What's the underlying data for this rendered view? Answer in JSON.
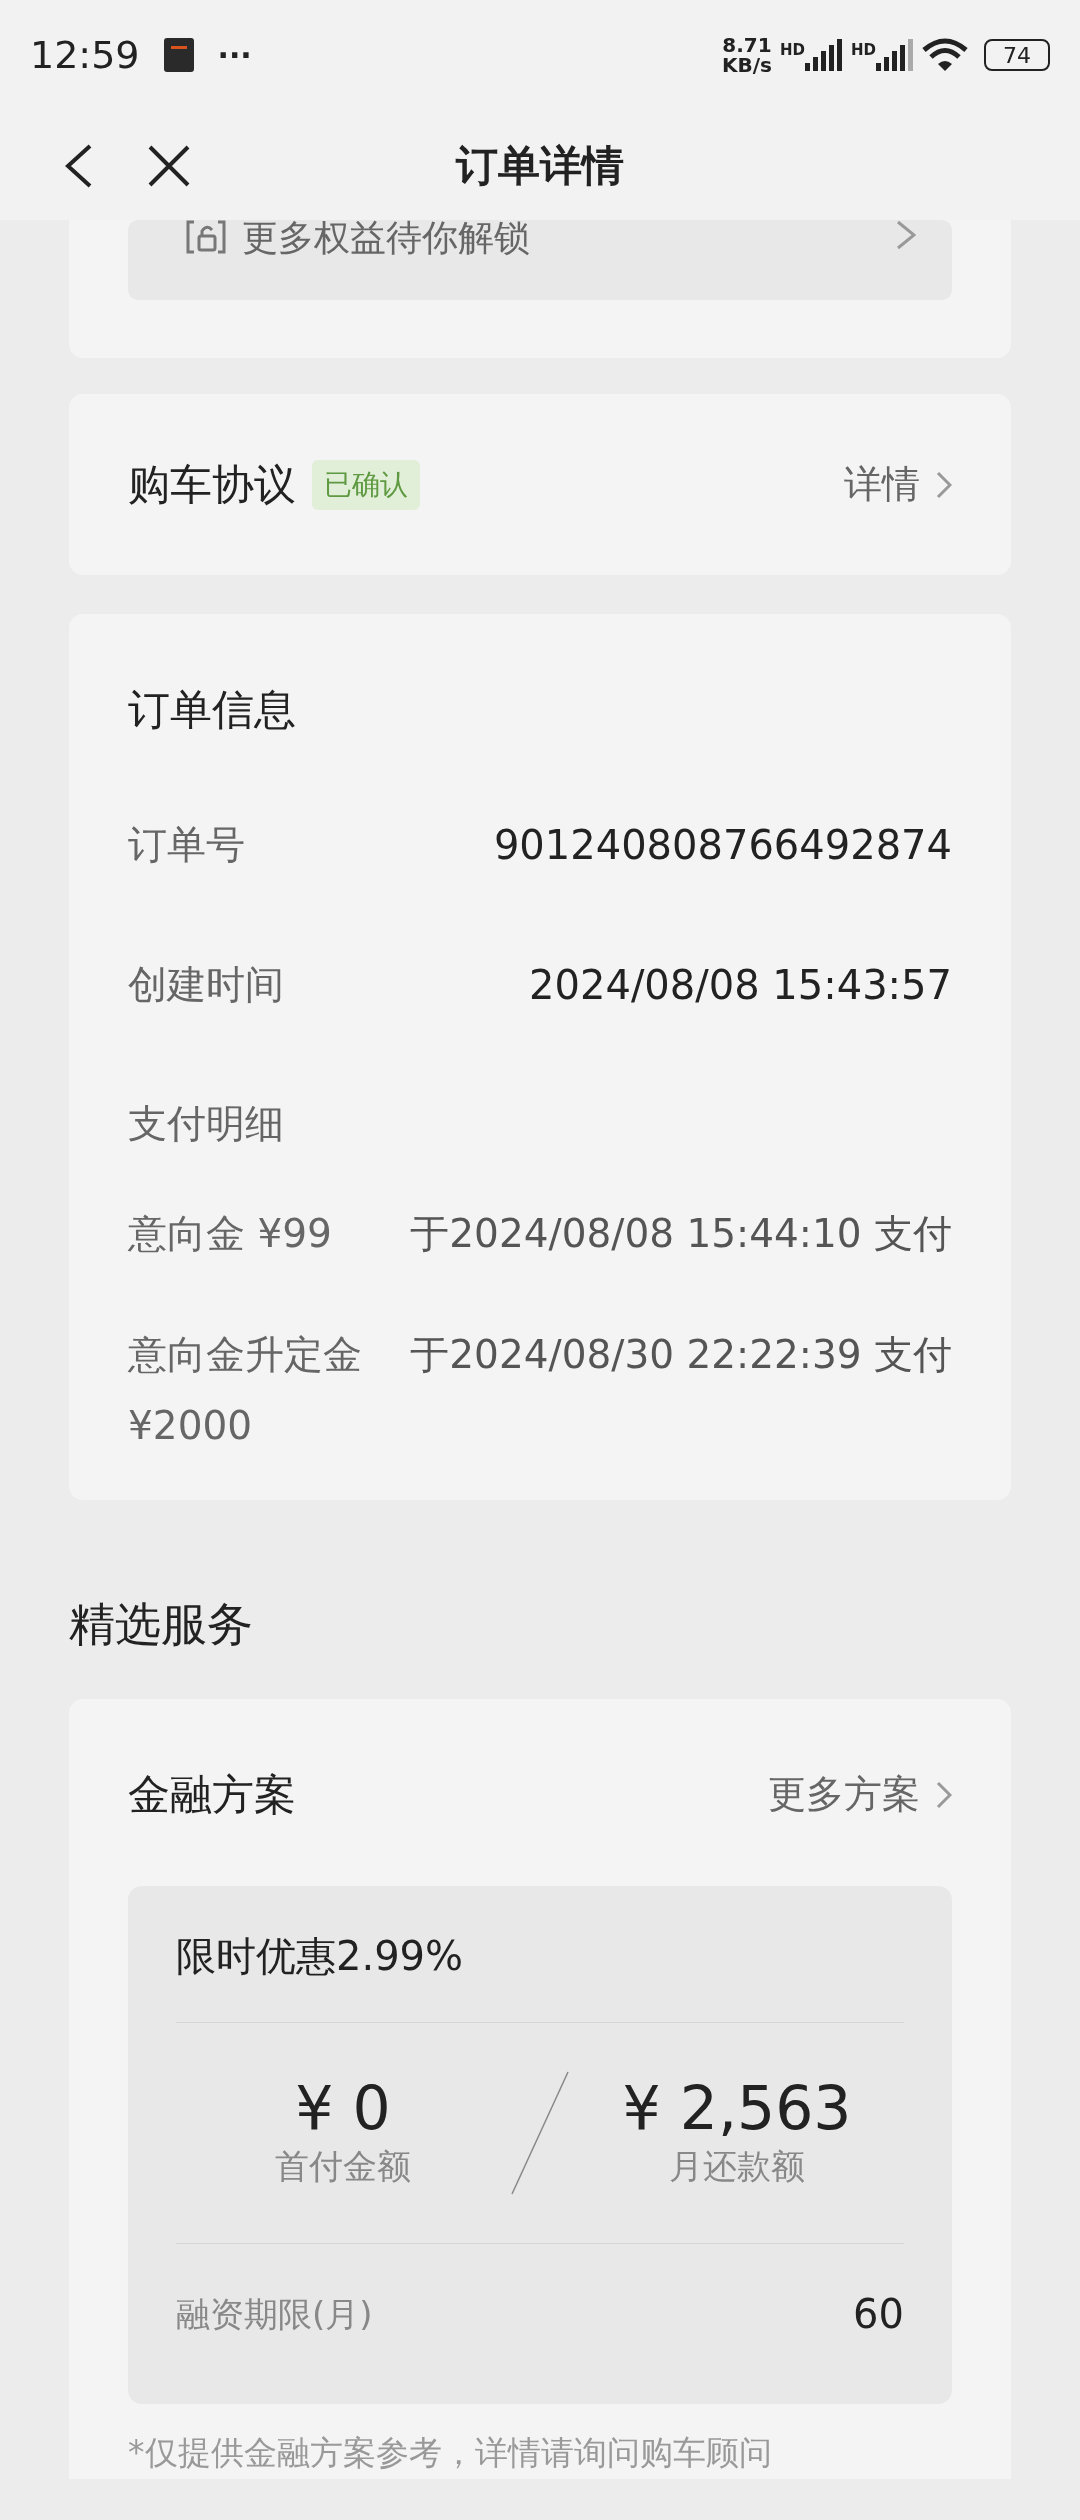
{
  "status_bar": {
    "time": "12:59",
    "more": "···",
    "net_speed": [
      "8.71",
      "KB/s"
    ],
    "signal_labels": [
      "HD",
      "HD"
    ],
    "battery": "74"
  },
  "header": {
    "title": "订单详情"
  },
  "benefits": {
    "label": "更多权益待你解锁"
  },
  "agreement": {
    "title": "购车协议",
    "badge": "已确认",
    "link": "详情"
  },
  "order_info": {
    "title": "订单信息",
    "rows": [
      {
        "label": "订单号",
        "value": "901240808766492874"
      },
      {
        "label": "创建时间",
        "value": "2024/08/08 15:43:57"
      }
    ],
    "payment_title": "支付明细",
    "payments": [
      {
        "label": "意向金 ¥99",
        "value": "于2024/08/08 15:44:10 支付"
      },
      {
        "label": "意向金升定金 ¥2000",
        "value": "于2024/08/30 22:22:39 支付"
      }
    ]
  },
  "section_title": "精选服务",
  "finance": {
    "title": "金融方案",
    "link": "更多方案",
    "plan": {
      "title": "限时优惠2.99%",
      "amounts": [
        {
          "value": "¥ 0",
          "label": "首付金额"
        },
        {
          "value": "¥ 2,563",
          "label": "月还款额"
        }
      ],
      "term_label": "融资期限(月)",
      "term_value": "60"
    },
    "note": "*仅提供金融方案参考，详情请询问购车顾问"
  }
}
